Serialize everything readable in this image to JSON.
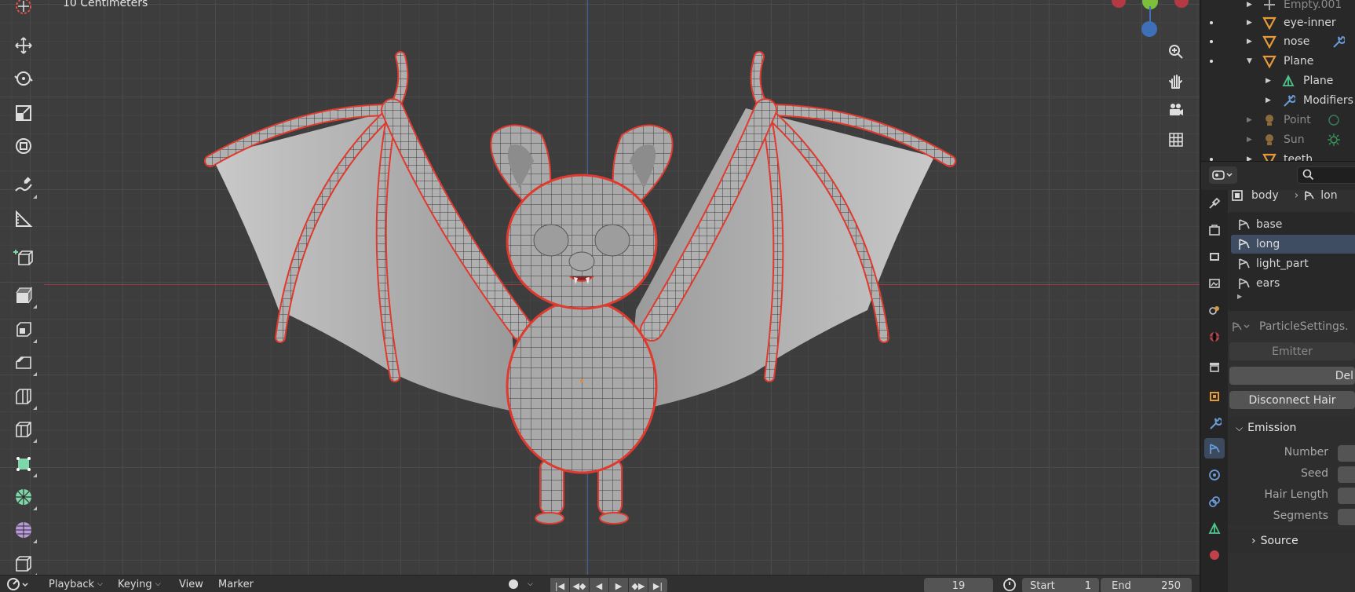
{
  "viewport": {
    "scale_label": "10 Centimeters"
  },
  "toolbar": {
    "tools": [
      "cursor-icon",
      "move-icon",
      "rotate-icon",
      "scale-icon",
      "transform-icon",
      "annotate-icon",
      "measure-icon",
      "add-cube-icon",
      "extrude-icon",
      "inset-icon",
      "bevel-icon",
      "loop-cut-icon",
      "knife-icon",
      "poly-build-icon",
      "spin-icon",
      "smooth-icon",
      "shear-icon"
    ]
  },
  "timeline": {
    "playback": "Playback",
    "keying": "Keying",
    "view": "View",
    "marker": "Marker",
    "current_frame": "19",
    "start_label": "Start",
    "start_value": "1",
    "end_label": "End",
    "end_value": "250"
  },
  "outliner": {
    "items": [
      {
        "name": "Empty.001",
        "dim": true
      },
      {
        "name": "eye-inner"
      },
      {
        "name": "nose"
      },
      {
        "name": "Plane"
      },
      {
        "name": "Plane"
      },
      {
        "name": "Modifiers"
      },
      {
        "name": "Point",
        "dim": true
      },
      {
        "name": "Sun",
        "dim": true
      },
      {
        "name": "teeth"
      }
    ]
  },
  "properties": {
    "breadcrumb_object": "body",
    "breadcrumb_system": "lon",
    "particle_systems": [
      "base",
      "long",
      "light_part",
      "ears"
    ],
    "active_system": "long",
    "settings_name": "ParticleSettings.",
    "emitter_label": "Emitter",
    "delete_label": "Del",
    "disconnect_hair_label": "Disconnect Hair",
    "emission_header": "Emission",
    "fields": [
      "Number",
      "Seed",
      "Hair Length",
      "Segments"
    ],
    "source_header": "Source"
  },
  "colors": {
    "accent": "#4772b3",
    "selection_outline": "#e03a2f",
    "mesh_fill": "#a8a8a8",
    "viewport_bg": "#3d3d3d"
  }
}
